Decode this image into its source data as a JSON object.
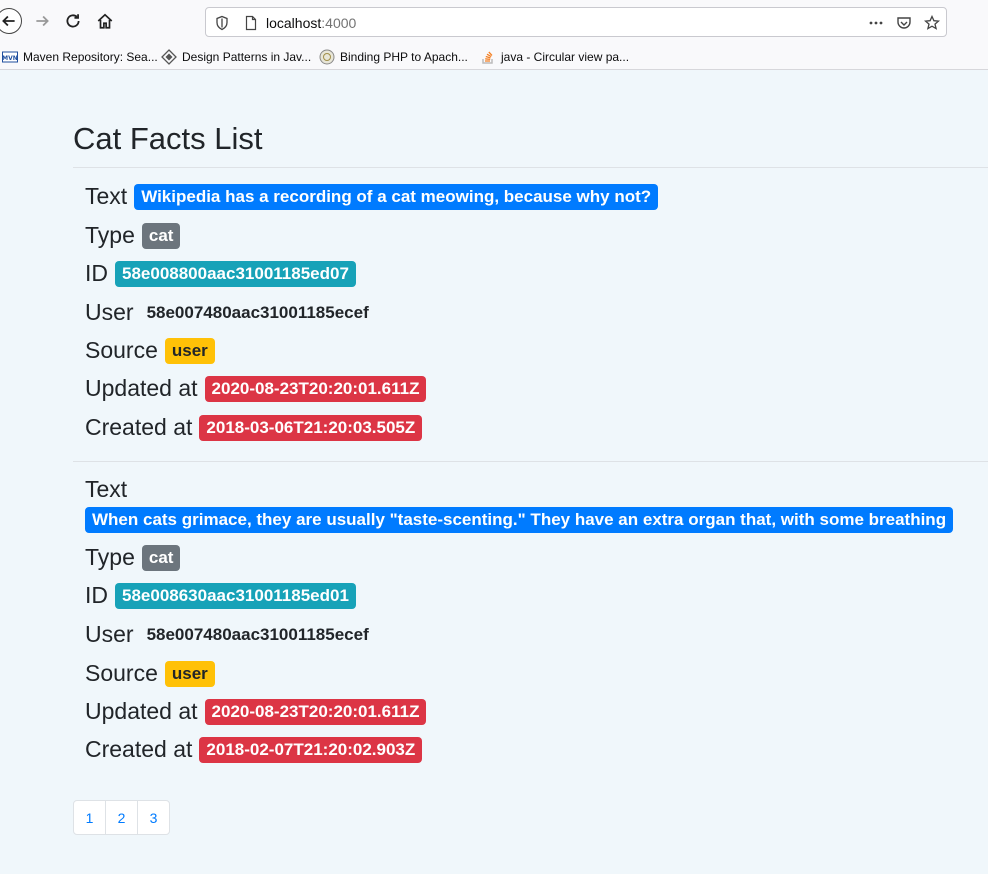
{
  "browser": {
    "url_host": "localhost",
    "url_port": ":4000",
    "bookmarks": [
      {
        "label": "Maven Repository: Sea...",
        "icon": "maven-icon"
      },
      {
        "label": "Design Patterns in Jav...",
        "icon": "diamond-icon"
      },
      {
        "label": "Binding PHP to Apach...",
        "icon": "php-icon"
      },
      {
        "label": "java - Circular view pa...",
        "icon": "stackoverflow-icon"
      }
    ]
  },
  "page": {
    "title": "Cat Facts List"
  },
  "facts": [
    {
      "text_label": "Text",
      "text": "Wikipedia has a recording of a cat meowing, because why not?",
      "type_label": "Type",
      "type": "cat",
      "id_label": "ID",
      "id": "58e008800aac31001185ed07",
      "user_label": "User",
      "user": "58e007480aac31001185ecef",
      "source_label": "Source",
      "source": "user",
      "updated_label": "Updated at",
      "updated": "2020-08-23T20:20:01.611Z",
      "created_label": "Created at",
      "created": "2018-03-06T21:20:03.505Z"
    },
    {
      "text_label": "Text",
      "text": "When cats grimace, they are usually \"taste-scenting.\" They have an extra organ that, with some breathing",
      "type_label": "Type",
      "type": "cat",
      "id_label": "ID",
      "id": "58e008630aac31001185ed01",
      "user_label": "User",
      "user": "58e007480aac31001185ecef",
      "source_label": "Source",
      "source": "user",
      "updated_label": "Updated at",
      "updated": "2020-08-23T20:20:01.611Z",
      "created_label": "Created at",
      "created": "2018-02-07T21:20:02.903Z"
    }
  ],
  "pagination": [
    "1",
    "2",
    "3"
  ],
  "colors": {
    "primary": "#007bff",
    "secondary": "#6c757d",
    "info": "#17a2b8",
    "warning": "#ffc107",
    "danger": "#dc3545"
  }
}
